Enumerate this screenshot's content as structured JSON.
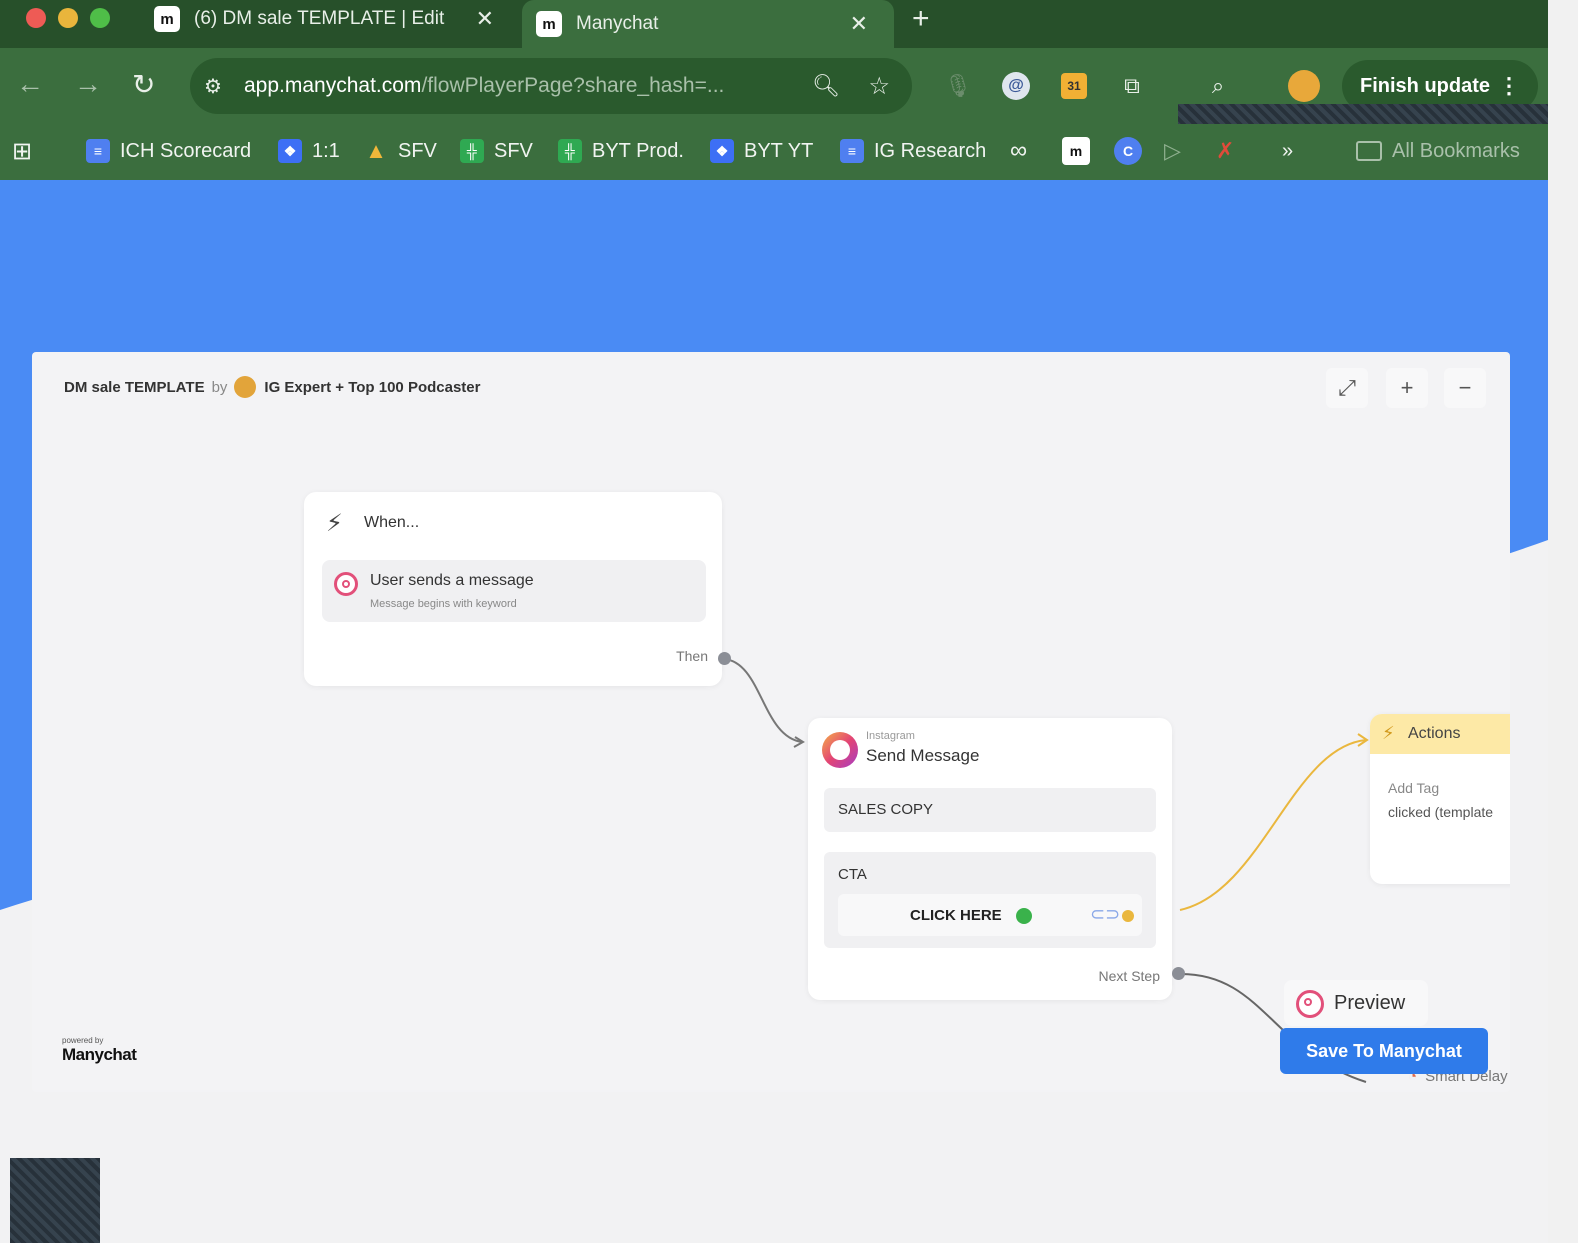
{
  "browser": {
    "tabs": [
      {
        "label": "(6) DM sale TEMPLATE | Edit",
        "active": false,
        "favicon": "m"
      },
      {
        "label": "Manychat",
        "active": true,
        "favicon": "m"
      }
    ],
    "new_tab_icon": "plus-icon",
    "url_host": "app.manychat.com",
    "url_path": "/flowPlayerPage?share_hash=...",
    "finish_update_label": "Finish update",
    "bookmarks": [
      {
        "label": "ICH Scorecard",
        "icon": "docs-icon",
        "color": "#4f7ff0"
      },
      {
        "label": "1:1",
        "icon": "dropbox-icon",
        "color": "#3d6ff5"
      },
      {
        "label": "SFV",
        "icon": "drive-icon",
        "color": "#f0b73a"
      },
      {
        "label": "SFV",
        "icon": "sheets-icon",
        "color": "#2fa952"
      },
      {
        "label": "BYT Prod.",
        "icon": "sheets-icon",
        "color": "#2fa952"
      },
      {
        "label": "BYT YT",
        "icon": "dropbox-icon",
        "color": "#3d6ff5"
      },
      {
        "label": "IG Research",
        "icon": "docs-icon",
        "color": "#4f7ff0"
      }
    ],
    "all_bookmarks_label": "All Bookmarks",
    "colors": {
      "frame": "#27502a",
      "toolbar": "#3b6e3e",
      "page_blue": "#4a8bf4"
    }
  },
  "flow": {
    "template_name": "DM sale TEMPLATE",
    "by_label": "by",
    "author": "IG Expert + Top 100 Podcaster",
    "trigger": {
      "when_label": "When...",
      "title": "User sends a message",
      "subtitle": "Message begins with keyword",
      "then_label": "Then"
    },
    "send_message": {
      "kicker": "Instagram",
      "title": "Send Message",
      "sales_copy": "SALES COPY",
      "cta_label": "CTA",
      "cta_button": "CLICK HERE",
      "next_step_label": "Next Step"
    },
    "actions": {
      "title": "Actions",
      "add_tag_label": "Add Tag",
      "tag_value": "clicked (template"
    },
    "preview_label": "Preview",
    "save_label": "Save To Manychat",
    "smart_delay_label": "Smart Delay",
    "powered_by": "powered by",
    "brand": "Manychat"
  }
}
